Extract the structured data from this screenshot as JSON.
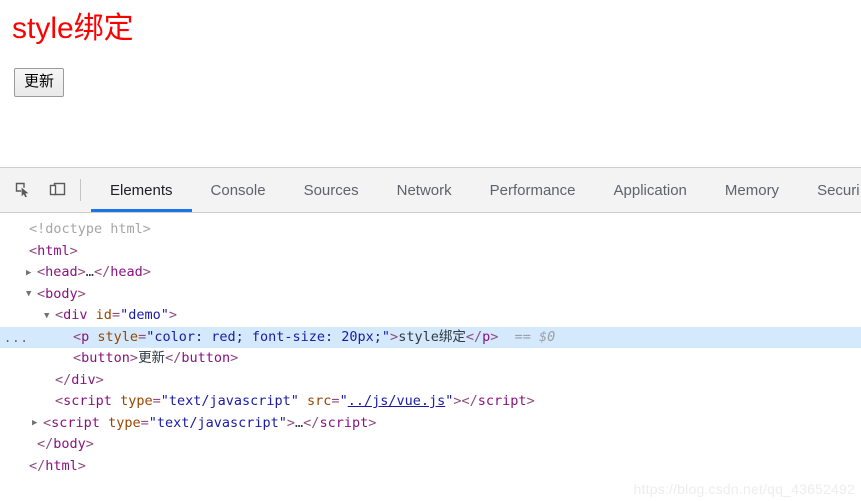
{
  "page": {
    "heading": "style绑定",
    "heading_color": "#ff0000",
    "button_label": "更新"
  },
  "devtools": {
    "toolbar": {
      "inspect_icon": "inspect-element-icon",
      "device_icon": "device-toolbar-icon"
    },
    "tabs": [
      {
        "label": "Elements",
        "active": true
      },
      {
        "label": "Console",
        "active": false
      },
      {
        "label": "Sources",
        "active": false
      },
      {
        "label": "Network",
        "active": false
      },
      {
        "label": "Performance",
        "active": false
      },
      {
        "label": "Application",
        "active": false
      },
      {
        "label": "Memory",
        "active": false
      },
      {
        "label": "Securi",
        "active": false
      }
    ],
    "accent_color": "#1a73e8",
    "selected_row_color": "#d4e9fc",
    "dom_rows": [
      {
        "twisty": "",
        "text": "<!doctype html>"
      },
      {
        "twisty": "",
        "text": "<html>"
      },
      {
        "twisty": "collapsed",
        "text": "<head>…</head>"
      },
      {
        "twisty": "expanded",
        "text": "<body>"
      },
      {
        "twisty": "expanded",
        "text": "<div id=\"demo\">"
      },
      {
        "twisty": "",
        "text": "<p style=\"color: red; font-size: 20px;\">style绑定</p>  == $0",
        "selected": true,
        "badge": "..."
      },
      {
        "twisty": "",
        "text": "<button>更新</button>"
      },
      {
        "twisty": "",
        "text": "</div>"
      },
      {
        "twisty": "",
        "text": "<script type=\"text/javascript\" src=\"../js/vue.js\"></script>"
      },
      {
        "twisty": "collapsed",
        "text": "<script type=\"text/javascript\">…</script>"
      },
      {
        "twisty": "",
        "text": "</body>"
      },
      {
        "twisty": "",
        "text": "</html>"
      }
    ],
    "dom_values": {
      "doctype": "<!doctype html>",
      "html_open": "html",
      "head_tag": "head",
      "body_tag": "body",
      "div_tag": "div",
      "div_attr_name": "id",
      "div_attr_value": "\"demo\"",
      "p_tag": "p",
      "p_attr_name": "style",
      "p_attr_value": "\"color: red; font-size: 20px;\"",
      "p_text": "style绑定",
      "p_suffix": "== $0",
      "button_tag": "button",
      "button_text": "更新",
      "script_tag": "script",
      "script_attr_type_name": "type",
      "script_attr_type_value": "\"text/javascript\"",
      "script_attr_src_name": "src",
      "script_attr_src_value": "../js/vue.js",
      "ellipsis": "…"
    }
  },
  "watermark": "https://blog.csdn.net/qq_43652492"
}
